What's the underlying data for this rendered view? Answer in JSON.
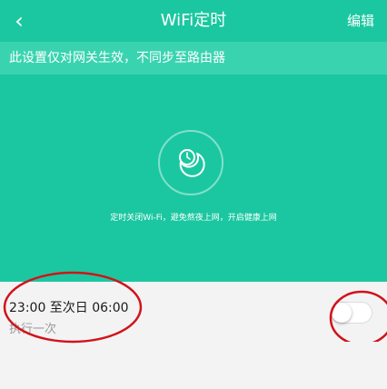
{
  "header": {
    "title": "WiFi定时",
    "edit_label": "编辑",
    "back_icon": "chevron-left-icon"
  },
  "notice": {
    "text": "此设置仅对网关生效，不同步至路由器"
  },
  "hero": {
    "icon": "clock-moon-icon",
    "description": "定时关闭Wi-Fi，避免熬夜上网，开启健康上网"
  },
  "schedule": {
    "time_range": "23:00 至次日 06:00",
    "repeat": "执行一次",
    "enabled": false
  },
  "colors": {
    "primary": "#1bc7a0",
    "notice_bg": "#3ad3b0",
    "annotation": "#d1131a"
  }
}
